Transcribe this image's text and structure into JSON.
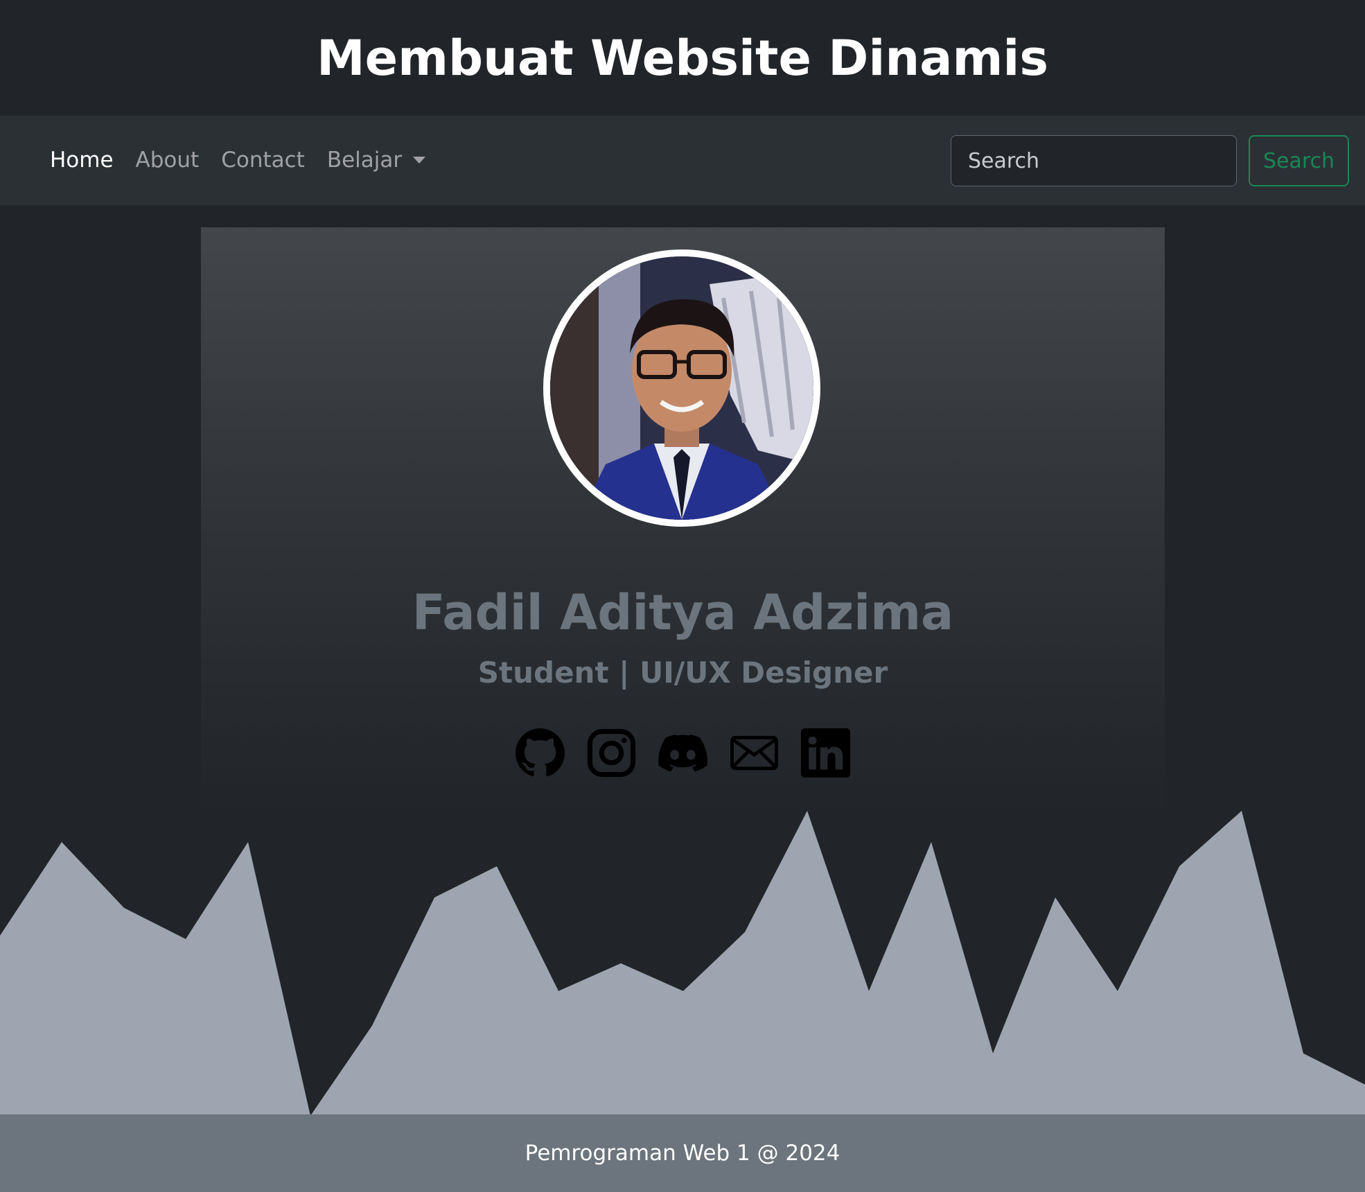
{
  "header": {
    "title": "Membuat Website Dinamis"
  },
  "navbar": {
    "items": [
      {
        "label": "Home",
        "active": true
      },
      {
        "label": "About",
        "active": false
      },
      {
        "label": "Contact",
        "active": false
      },
      {
        "label": "Belajar",
        "active": false,
        "dropdown": true
      }
    ],
    "search": {
      "placeholder": "Search",
      "value": "",
      "button_label": "Search"
    }
  },
  "profile": {
    "name": "Fadil Aditya Adzima",
    "role": "Student | UI/UX Designer",
    "avatar_icon": "profile-photo",
    "social_icons": [
      "github-icon",
      "instagram-icon",
      "discord-icon",
      "envelope-icon",
      "linkedin-icon"
    ]
  },
  "footer": {
    "text": "Pemrograman Web 1 @ 2024"
  },
  "colors": {
    "background": "#212529",
    "navbar": "#2b3035",
    "accent_success": "#198754",
    "muted_text": "#6c757d",
    "wave": "#9ea5b0",
    "footer": "#6c757d"
  }
}
